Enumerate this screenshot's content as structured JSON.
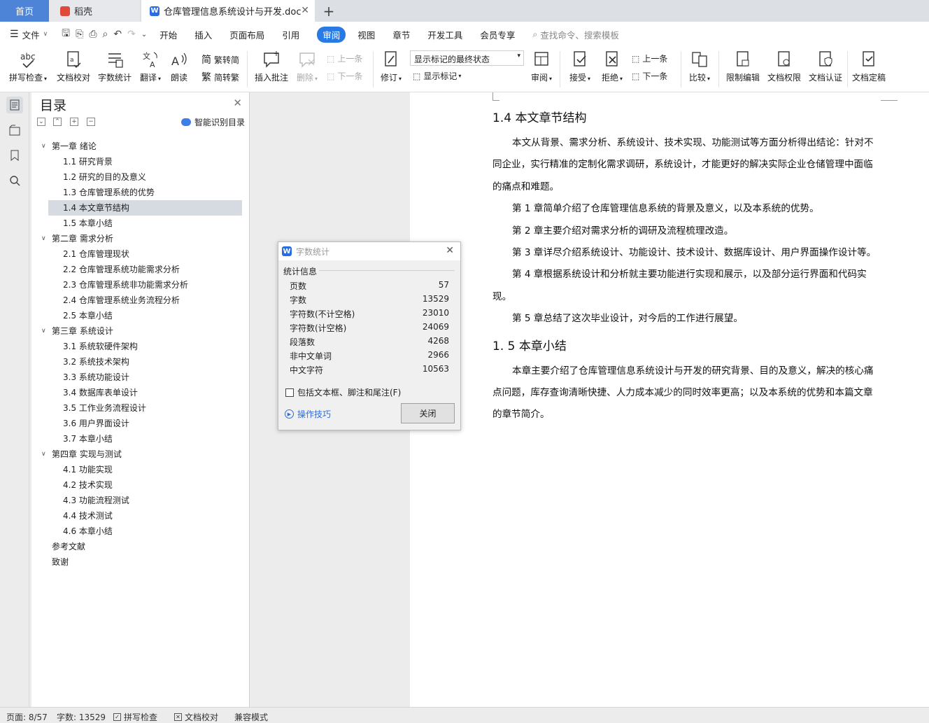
{
  "tabs": {
    "home": "首页",
    "daoke": "稻壳",
    "doc": "仓库管理信息系统设计与开发.doc"
  },
  "menu": [
    "文件",
    "开始",
    "插入",
    "页面布局",
    "引用",
    "审阅",
    "视图",
    "章节",
    "开发工具",
    "会员专享"
  ],
  "menu_active": "审阅",
  "search_placeholder": "查找命令、搜索模板",
  "toolbar": {
    "spell": "拼写检查",
    "proof": "文档校对",
    "count": "字数统计",
    "translate": "翻译",
    "read": "朗读",
    "t2s": "繁转简",
    "s2t": "简转繁",
    "comment": "插入批注",
    "delete": "删除",
    "prev": "上一条",
    "next": "下一条",
    "revise": "修订",
    "markup_state": "显示标记的最终状态",
    "show_markup": "显示标记",
    "review": "审阅",
    "accept": "接受",
    "reject": "拒绝",
    "prev2": "上一条",
    "next2": "下一条",
    "compare": "比较",
    "restrict": "限制编辑",
    "rights": "文档权限",
    "cert": "文档认证",
    "final": "文档定稿"
  },
  "toc": {
    "title": "目录",
    "smart": "智能识别目录",
    "items": [
      {
        "t": "第一章  绪论",
        "k": "ch"
      },
      {
        "t": "1.1  研究背景",
        "k": "sec"
      },
      {
        "t": "1.2  研究的目的及意义",
        "k": "sec"
      },
      {
        "t": "1.3  仓库管理系统的优势",
        "k": "sec"
      },
      {
        "t": "1.4  本文章节结构",
        "k": "sel"
      },
      {
        "t": "1.5 本章小结",
        "k": "sec"
      },
      {
        "t": "第二章  需求分析",
        "k": "ch"
      },
      {
        "t": "2.1  仓库管理现状",
        "k": "sec"
      },
      {
        "t": "2.2  仓库管理系统功能需求分析",
        "k": "sec"
      },
      {
        "t": "2.3 仓库管理系统非功能需求分析",
        "k": "sec"
      },
      {
        "t": "2.4 仓库管理系统业务流程分析",
        "k": "sec"
      },
      {
        "t": "2.5 本章小结",
        "k": "sec"
      },
      {
        "t": "第三章  系统设计",
        "k": "ch"
      },
      {
        "t": "3.1  系统软硬件架构",
        "k": "sec"
      },
      {
        "t": "3.2  系统技术架构",
        "k": "sec"
      },
      {
        "t": "3.3 系统功能设计",
        "k": "sec"
      },
      {
        "t": "3.4 数据库表单设计",
        "k": "sec"
      },
      {
        "t": "3.5 工作业务流程设计",
        "k": "sec"
      },
      {
        "t": "3.6  用户界面设计",
        "k": "sec"
      },
      {
        "t": "3.7 本章小结",
        "k": "sec"
      },
      {
        "t": "第四章  实现与测试",
        "k": "ch"
      },
      {
        "t": "4.1  功能实现",
        "k": "sec"
      },
      {
        "t": "4.2  技术实现",
        "k": "sec"
      },
      {
        "t": "4.3 功能流程测试",
        "k": "sec"
      },
      {
        "t": "4.4  技术测试",
        "k": "sec"
      },
      {
        "t": "4.6 本章小结",
        "k": "sec"
      },
      {
        "t": "参考文献",
        "k": "top"
      },
      {
        "t": "致谢",
        "k": "top"
      }
    ]
  },
  "doc": {
    "h1": "1.4 本文章节结构",
    "p1": "本文从背景、需求分析、系统设计、技术实现、功能测试等方面分析得出结论：针对不同企业，实行精准的定制化需求调研，系统设计，才能更好的解决实际企业仓储管理中面临的痛点和难题。",
    "p2": "第 1 章简单介绍了仓库管理信息系统的背景及意义，以及本系统的优势。",
    "p3": "第 2 章主要介绍对需求分析的调研及流程梳理改造。",
    "p4": "第 3 章详尽介绍系统设计、功能设计、技术设计、数据库设计、用户界面操作设计等。",
    "p5": "第 4 章根据系统设计和分析就主要功能进行实现和展示，以及部分运行界面和代码实现。",
    "p6": "第 5 章总结了这次毕业设计，对今后的工作进行展望。",
    "h2": "1. 5 本章小结",
    "p7": "本章主要介绍了仓库管理信息系统设计与开发的研究背景、目的及意义，解决的核心痛点问题，库存查询清晰快捷、人力成本减少的同时效率更高；以及本系统的优势和本篇文章的章节简介。"
  },
  "dialog": {
    "title": "字数统计",
    "section": "统计信息",
    "stats": [
      {
        "label": "页数",
        "value": "57"
      },
      {
        "label": "字数",
        "value": "13529"
      },
      {
        "label": "字符数(不计空格)",
        "value": "23010"
      },
      {
        "label": "字符数(计空格)",
        "value": "24069"
      },
      {
        "label": "段落数",
        "value": "4268"
      },
      {
        "label": "非中文单词",
        "value": "2966"
      },
      {
        "label": "中文字符",
        "value": "10563"
      }
    ],
    "checkbox": "包括文本框、脚注和尾注(F)",
    "tips": "操作技巧",
    "close": "关闭"
  },
  "status": {
    "page": "页面: 8/57",
    "words": "字数: 13529",
    "spell": "拼写检查",
    "proof": "文档校对",
    "compat": "兼容模式"
  }
}
